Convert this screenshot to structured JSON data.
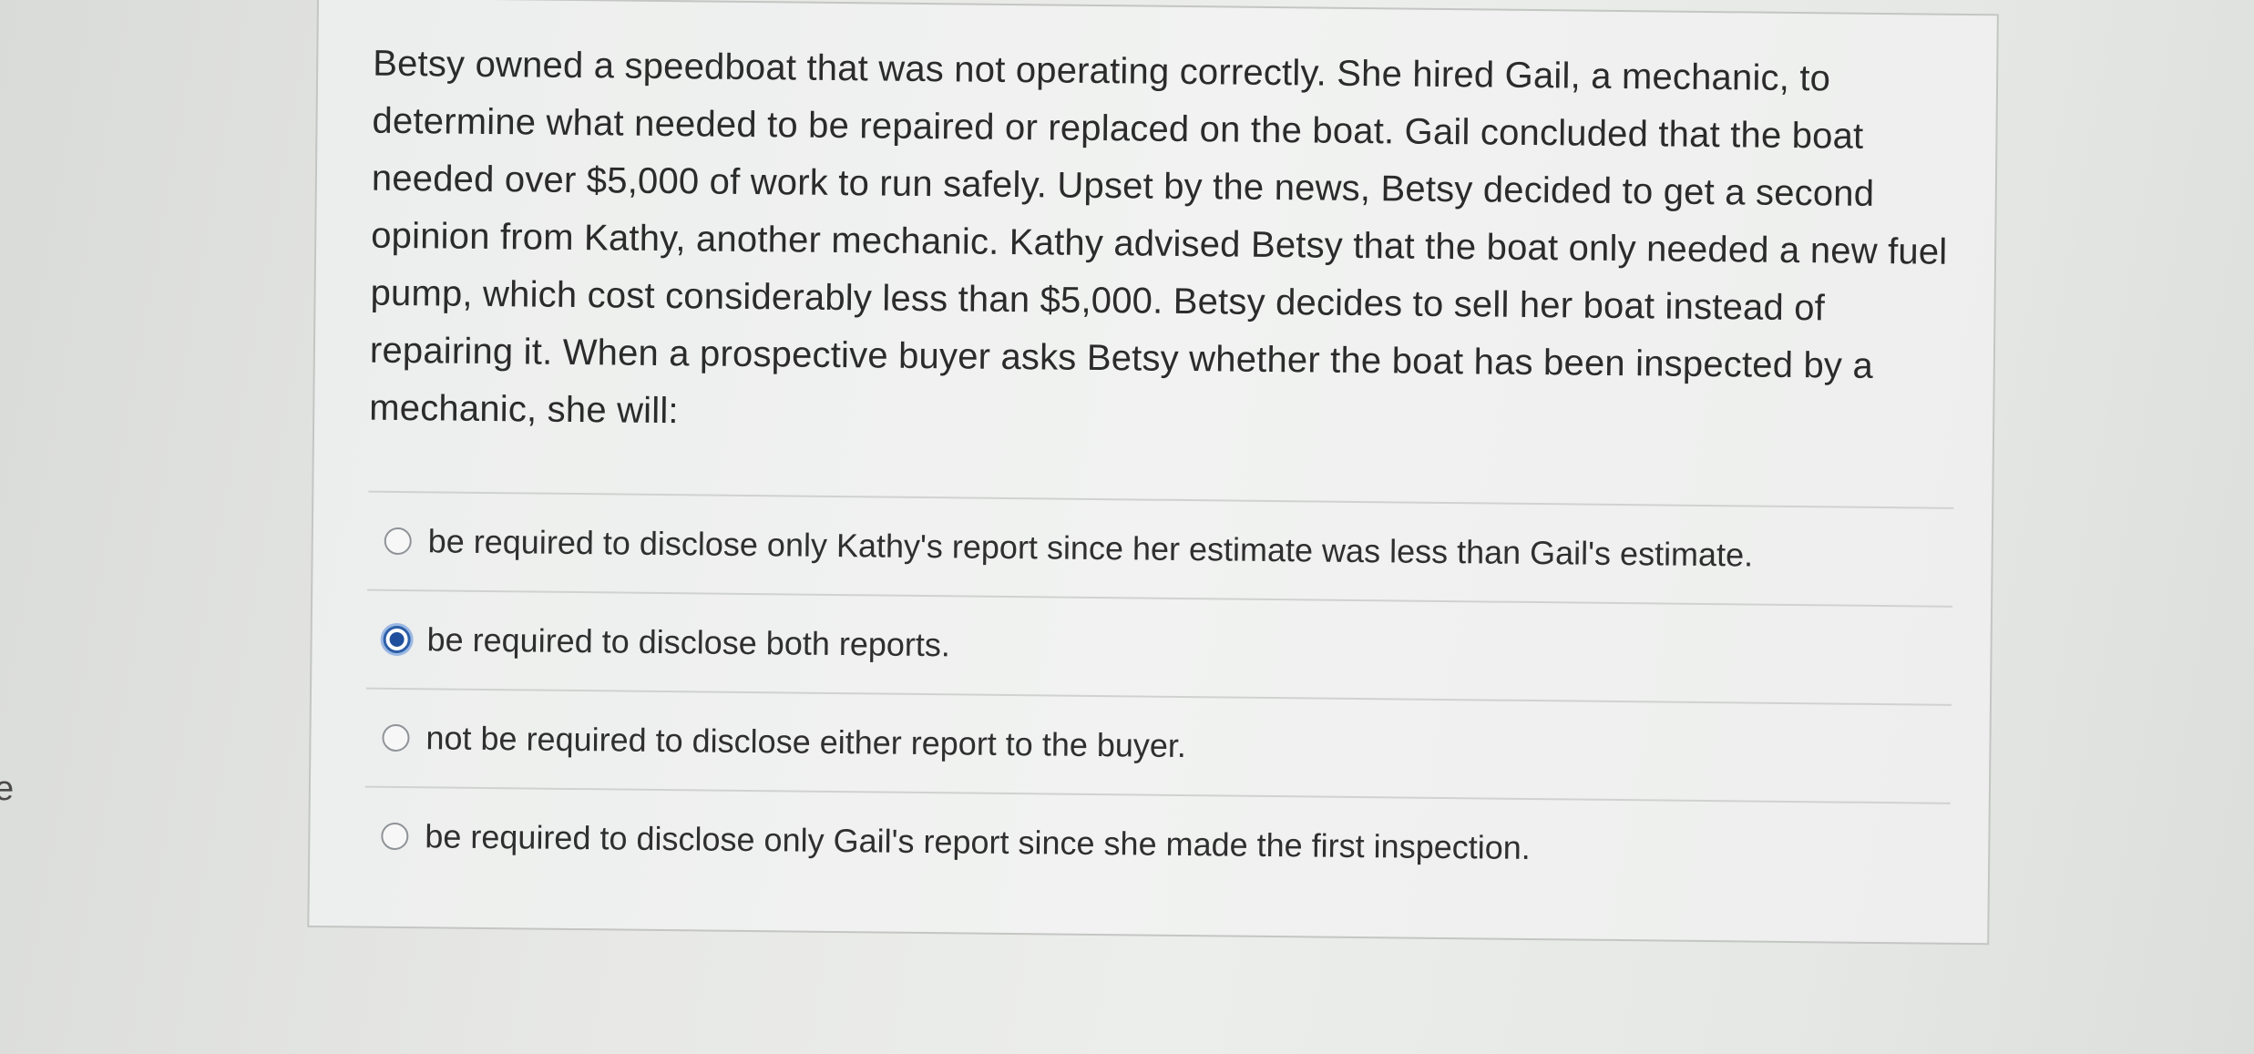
{
  "side_fragment": "e",
  "question": {
    "text": "Betsy owned a speedboat that was not operating correctly. She hired Gail, a mechanic, to determine what needed to be repaired or replaced on the boat. Gail concluded that the boat needed over $5,000 of work to run safely. Upset by the news, Betsy decided to get a second opinion from Kathy, another mechanic. Kathy advised Betsy that the boat only needed a new fuel pump, which cost considerably less than $5,000. Betsy decides to sell her boat instead of repairing it. When a prospective buyer asks Betsy whether the boat has been inspected by a mechanic, she will:"
  },
  "options": [
    {
      "label": "be required to disclose only Kathy's report since her estimate was less than Gail's estimate.",
      "selected": false
    },
    {
      "label": "be required to disclose both reports.",
      "selected": true
    },
    {
      "label": "not be required to disclose either report to the buyer.",
      "selected": false
    },
    {
      "label": "be required to disclose only Gail's report since she made the first inspection.",
      "selected": false
    }
  ],
  "colors": {
    "radio_selected": "#1f4f9c",
    "radio_ring": "#9bb8e3",
    "text": "#2b2b2b"
  }
}
